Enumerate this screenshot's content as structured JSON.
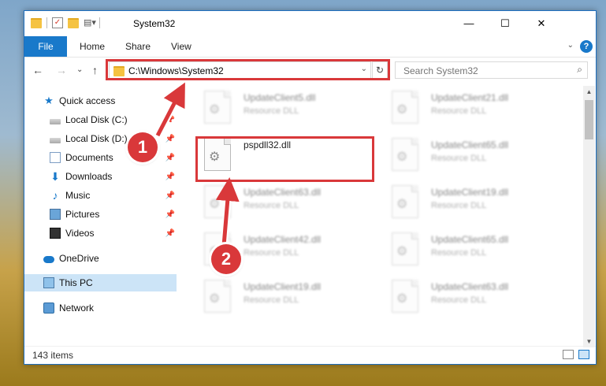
{
  "window": {
    "title": "System32",
    "min_glyph": "—",
    "max_glyph": "☐",
    "close_glyph": "✕"
  },
  "ribbon": {
    "tabs": [
      "File",
      "Home",
      "Share",
      "View"
    ],
    "help_glyph": "?",
    "expand_glyph": "⌄"
  },
  "navigation": {
    "back_glyph": "←",
    "forward_glyph": "→",
    "recent_glyph": "⌄",
    "up_glyph": "↑",
    "address_path": "C:\\Windows\\System32",
    "refresh_glyph": "↻",
    "search_placeholder": "Search System32"
  },
  "sidebar": {
    "items": [
      {
        "label": "Quick access",
        "icon": "star-icon",
        "pinned": false
      },
      {
        "label": "Local Disk (C:)",
        "icon": "disk-icon",
        "pinned": true
      },
      {
        "label": "Local Disk (D:)",
        "icon": "disk-icon",
        "pinned": true
      },
      {
        "label": "Documents",
        "icon": "documents-icon",
        "pinned": true
      },
      {
        "label": "Downloads",
        "icon": "downloads-icon",
        "pinned": true
      },
      {
        "label": "Music",
        "icon": "music-icon",
        "pinned": true
      },
      {
        "label": "Pictures",
        "icon": "pictures-icon",
        "pinned": true
      },
      {
        "label": "Videos",
        "icon": "videos-icon",
        "pinned": true
      },
      {
        "label": "OneDrive",
        "icon": "onedrive-icon",
        "pinned": false
      },
      {
        "label": "This PC",
        "icon": "this-pc-icon",
        "pinned": false,
        "selected": true
      },
      {
        "label": "Network",
        "icon": "network-icon",
        "pinned": false
      }
    ]
  },
  "files": [
    {
      "name": "UpdateClient5.dll",
      "type": "Resource DLL"
    },
    {
      "name": "UpdateClient21.dll",
      "type": "Resource DLL"
    },
    {
      "name": "pspdll32.dll",
      "type": ""
    },
    {
      "name": "UpdateClient65.dll",
      "type": "Resource DLL"
    },
    {
      "name": "UpdateClient63.dll",
      "type": "Resource DLL"
    },
    {
      "name": "UpdateClient19.dll",
      "type": "Resource DLL"
    },
    {
      "name": "UpdateClient42.dll",
      "type": "Resource DLL"
    },
    {
      "name": "UpdateClient65.dll",
      "type": "Resource DLL"
    },
    {
      "name": "UpdateClient19.dll",
      "type": "Resource DLL"
    },
    {
      "name": "UpdateClient63.dll",
      "type": "Resource DLL"
    }
  ],
  "status": {
    "item_count": "143 items"
  },
  "callouts": {
    "step1": "1",
    "step2": "2"
  },
  "colors": {
    "accent": "#1979ca",
    "highlight": "#d9383a",
    "selected_bg": "#cce4f7"
  }
}
